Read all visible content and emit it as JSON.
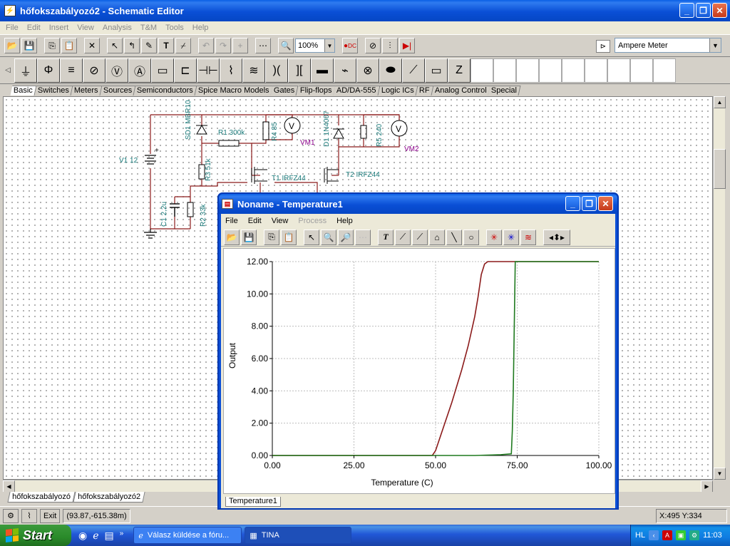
{
  "main_window": {
    "title": "hőfokszabályozó2 - Schematic Editor",
    "menu": [
      "File",
      "Edit",
      "Insert",
      "View",
      "Analysis",
      "T&M",
      "Tools",
      "Help"
    ],
    "zoom": "100%",
    "component_selected": "Ampere Meter",
    "component_tabs": [
      "Basic",
      "Switches",
      "Meters",
      "Sources",
      "Semiconductors",
      "Spice Macro Models",
      "Gates",
      "Flip-flops",
      "AD/DA-555",
      "Logic ICs",
      "RF",
      "Analog Control",
      "Special"
    ],
    "sheet_tabs": [
      "hőfokszabályozó",
      "hőfokszabályozó2"
    ],
    "status": {
      "exit_label": "Exit",
      "value": "(93.87,-615.38m)",
      "coords": "X:495 Y:334"
    }
  },
  "schematic": {
    "labels": {
      "sd1": "SD1 MBR10",
      "r1": "R1 300k",
      "r4": "R4 85",
      "vm1": "VM1",
      "d1": "D1 1N4007",
      "r5": "R5 240",
      "vm2": "VM2",
      "v1": "V1 12",
      "r3": "R3 51k",
      "t1": "T1 IRFZ44",
      "t2": "T2 IRFZ44",
      "c1": "C1 2,2u",
      "r2": "R2 33k",
      "v": "V",
      "plus": "+"
    }
  },
  "graph_window": {
    "title": "Noname - Temperature1",
    "menu": [
      "File",
      "Edit",
      "View",
      "Process",
      "Help"
    ],
    "menu_disabled": [
      "Process"
    ],
    "sheet_tab": "Temperature1"
  },
  "chart_data": {
    "type": "line",
    "xlabel": "Temperature (C)",
    "ylabel": "Output",
    "xlim": [
      0,
      100
    ],
    "ylim": [
      0,
      12
    ],
    "x_ticks": [
      "0.00",
      "25.00",
      "50.00",
      "75.00",
      "100.00"
    ],
    "y_ticks": [
      "0.00",
      "2.00",
      "4.00",
      "6.00",
      "8.00",
      "10.00",
      "12.00"
    ],
    "grid": true,
    "series": [
      {
        "color": "#8b1a1a",
        "x": [
          0,
          49.0,
          50,
          52,
          55,
          58,
          60,
          62,
          63,
          64,
          65,
          66,
          100
        ],
        "y": [
          0,
          0,
          0.3,
          1.5,
          3.3,
          5.3,
          6.8,
          8.6,
          9.8,
          11.2,
          11.85,
          12,
          12
        ]
      },
      {
        "color": "#1f7a1f",
        "x": [
          0,
          62,
          70,
          73.2,
          73.5,
          73.8,
          74.1,
          74.4,
          100
        ],
        "y": [
          0,
          0,
          0.05,
          0.1,
          1.5,
          4,
          8,
          12,
          12
        ]
      }
    ]
  },
  "taskbar": {
    "start": "Start",
    "items": [
      "Válasz küldése a fóru...",
      "TINA"
    ],
    "lang": "HL",
    "time": "11:03"
  }
}
